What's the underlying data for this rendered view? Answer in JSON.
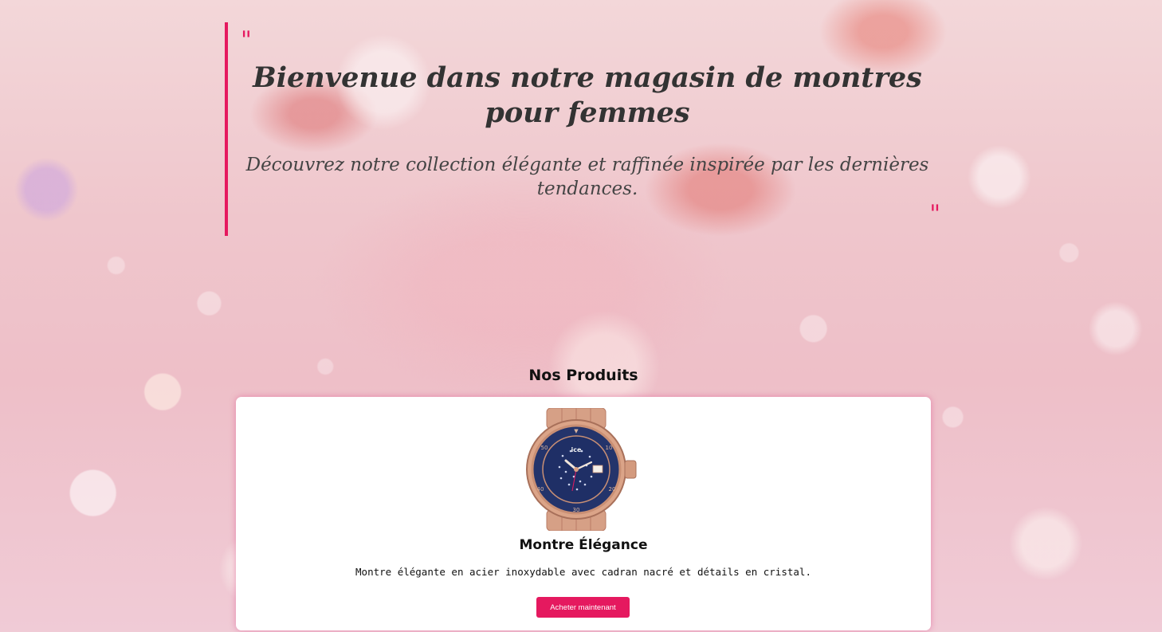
{
  "hero": {
    "title": "Bienvenue dans notre magasin de montres pour femmes",
    "subtitle": "Découvrez notre collection élégante et raffinée inspirée par les dernières tendances.",
    "open_quote": "\"",
    "close_quote": "\""
  },
  "products": {
    "heading": "Nos Produits",
    "items": [
      {
        "name": "Montre Élégance",
        "description": "Montre élégante en acier inoxydable avec cadran nacré et détails en cristal.",
        "button_label": "Acheter maintenant",
        "image_icon": "wrist-watch-icon",
        "watch_brand_text": "ice"
      }
    ]
  },
  "colors": {
    "accent": "#e5195f",
    "card_background": "#ffffff",
    "watch_dial": "#1f2f66",
    "watch_case": "#d9a083"
  }
}
